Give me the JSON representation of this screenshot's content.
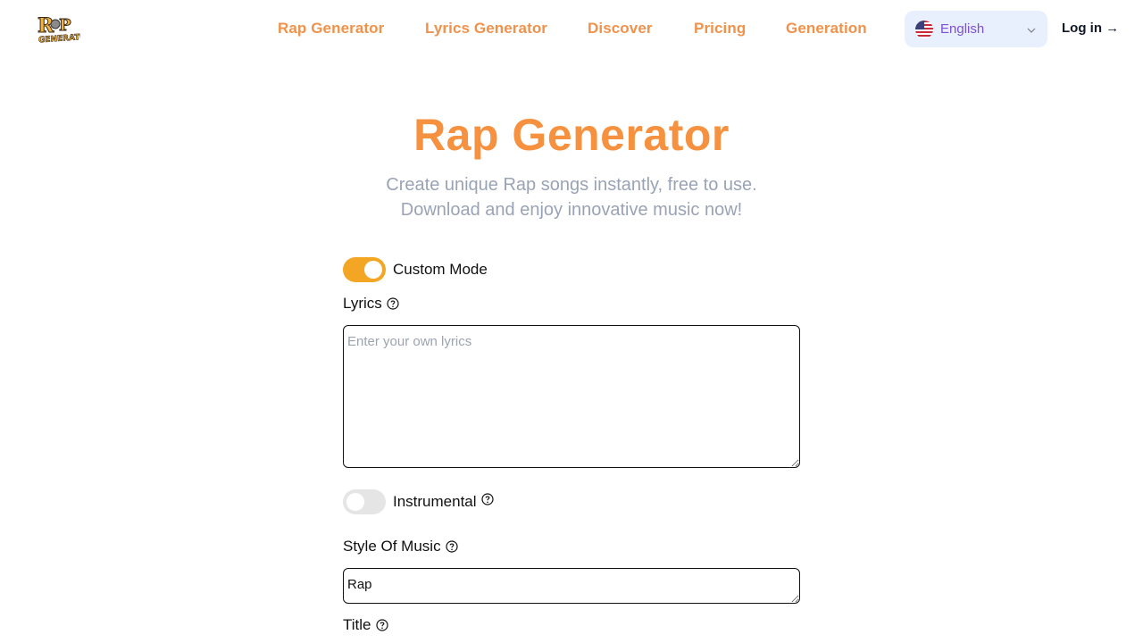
{
  "header": {
    "logo_alt": "Rap Generator",
    "nav": [
      {
        "label": "Rap Generator"
      },
      {
        "label": "Lyrics Generator"
      },
      {
        "label": "Discover"
      },
      {
        "label": "Pricing"
      },
      {
        "label": "Generation"
      }
    ],
    "language": {
      "selected": "English",
      "flag_icon": "us-flag-icon"
    },
    "login_label": "Log in →"
  },
  "hero": {
    "title": "Rap Generator",
    "subtitle_line1": "Create unique Rap songs instantly, free to use.",
    "subtitle_line2": "Download and enjoy innovative music now!"
  },
  "form": {
    "custom_mode": {
      "label": "Custom Mode",
      "enabled": true
    },
    "lyrics": {
      "label": "Lyrics",
      "placeholder": "Enter your own lyrics",
      "value": ""
    },
    "instrumental": {
      "label": "Instrumental",
      "enabled": false
    },
    "style": {
      "label": "Style Of Music",
      "value": "Rap"
    },
    "title": {
      "label": "Title"
    }
  },
  "colors": {
    "accent": "#f5913f",
    "toggle_on": "#f3a524",
    "language_bg": "#e8f0fd",
    "language_text": "#7e4fd6"
  }
}
